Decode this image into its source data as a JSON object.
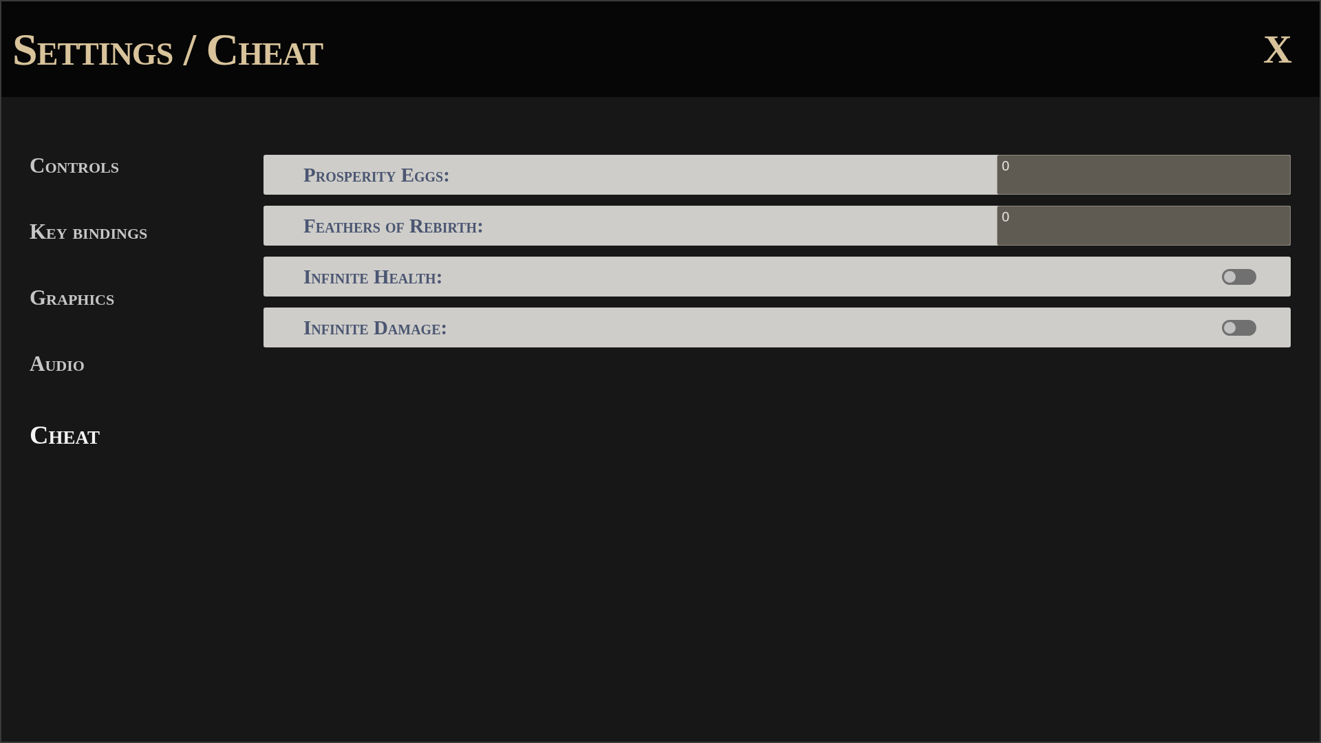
{
  "header": {
    "title": "Settings / Cheat",
    "close_label": "X"
  },
  "sidebar": {
    "items": [
      {
        "label": "Controls",
        "selected": false
      },
      {
        "label": "Key bindings",
        "selected": false
      },
      {
        "label": "Graphics",
        "selected": false
      },
      {
        "label": "Audio",
        "selected": false
      },
      {
        "label": "Cheat",
        "selected": true
      }
    ]
  },
  "cheats": [
    {
      "kind": "number",
      "label": "Prosperity Eggs:",
      "value": "0"
    },
    {
      "kind": "number",
      "label": "Feathers of Rebirth:",
      "value": "0"
    },
    {
      "kind": "toggle",
      "label": "Infinite Health:",
      "on": false
    },
    {
      "kind": "toggle",
      "label": "Infinite Damage:",
      "on": false
    }
  ]
}
